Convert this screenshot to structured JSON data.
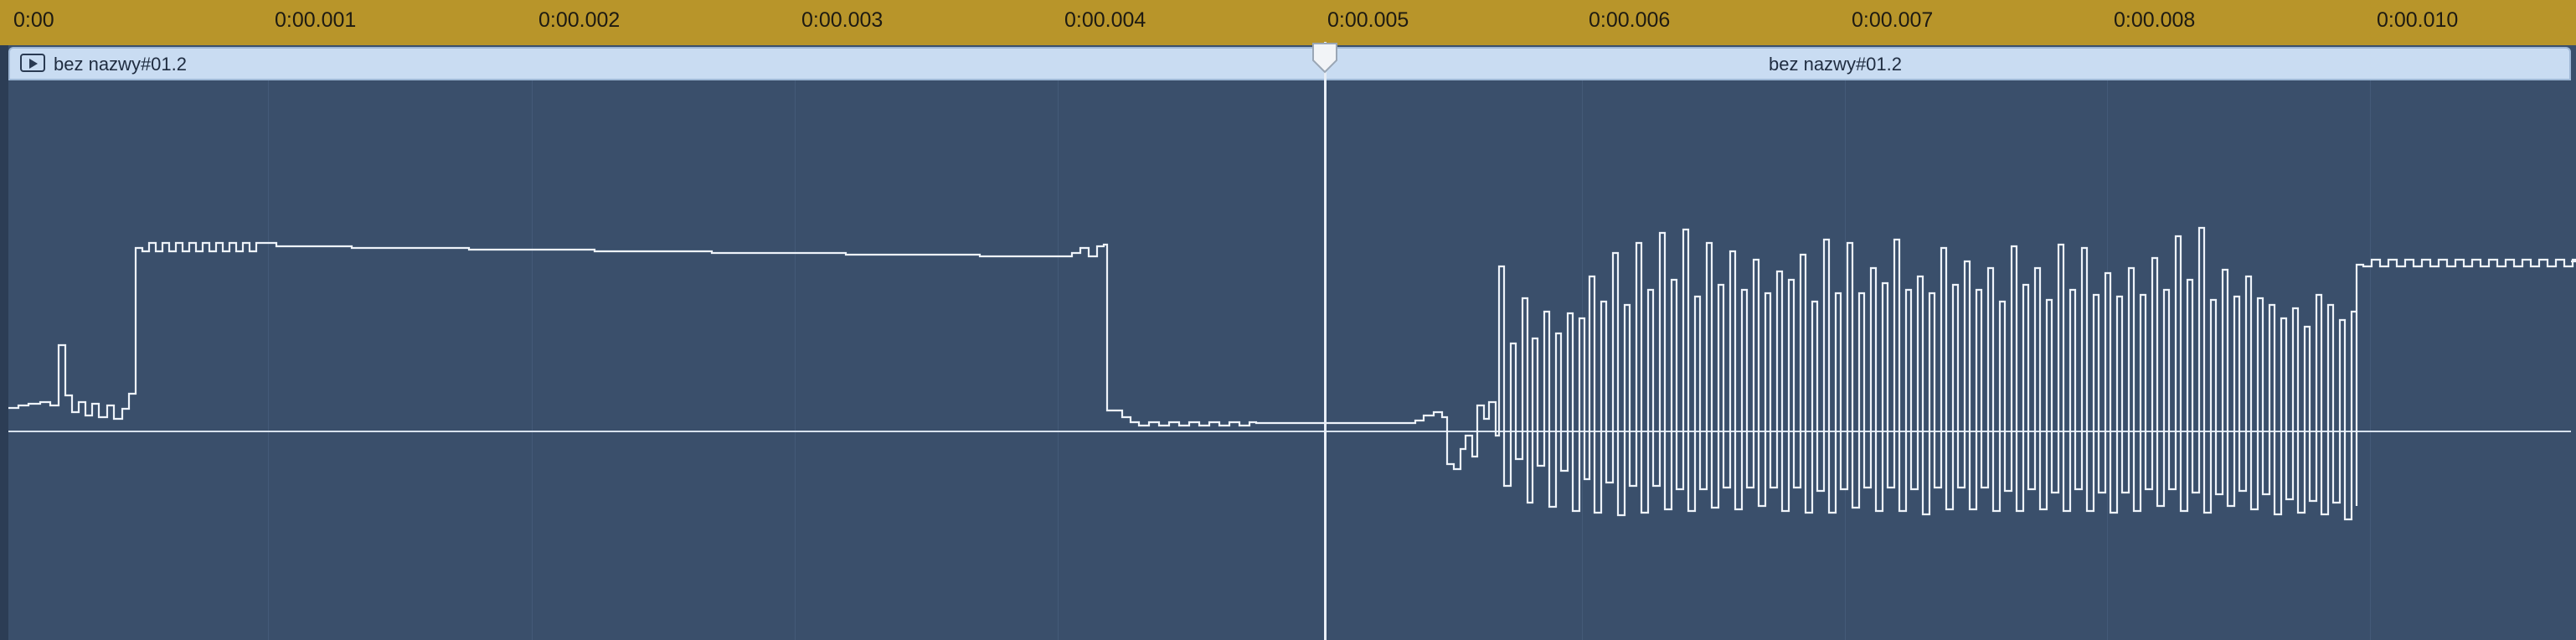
{
  "ruler": {
    "labels": [
      "0:00",
      "0:00.001",
      "0:00.002",
      "0:00.003",
      "0:00.004",
      "0:00.005",
      "0:00.006",
      "0:00.007",
      "0:00.008",
      "0:00.010"
    ]
  },
  "clip": {
    "name_left": "bez nazwy#01.2",
    "name_center": "bez nazwy#01.2"
  },
  "playhead": {
    "time": "0:00.005"
  },
  "colors": {
    "ruler": "#b8952a",
    "track_background": "#3a4f6b",
    "clip_header": "#c9dcf2",
    "waveform": "#eef3fa"
  },
  "icons": {
    "clip": "play-icon"
  }
}
